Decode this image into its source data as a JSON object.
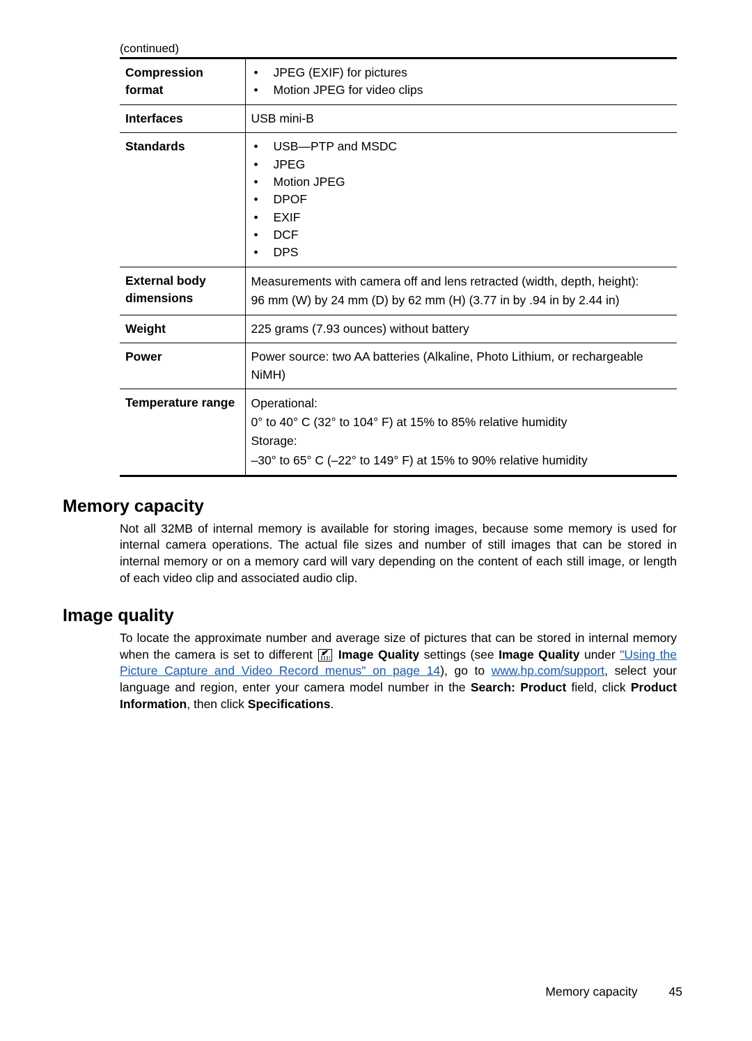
{
  "continued": "(continued)",
  "specs": {
    "compression": {
      "label": "Compression format",
      "items": [
        "JPEG (EXIF) for pictures",
        "Motion JPEG for video clips"
      ]
    },
    "interfaces": {
      "label": "Interfaces",
      "value": "USB mini-B"
    },
    "standards": {
      "label": "Standards",
      "items": [
        "USB—PTP and MSDC",
        "JPEG",
        "Motion JPEG",
        "DPOF",
        "EXIF",
        "DCF",
        "DPS"
      ]
    },
    "external": {
      "label": "External body dimensions",
      "lines": [
        "Measurements with camera off and lens retracted (width, depth, height):",
        "96 mm (W) by 24 mm (D) by 62 mm (H) (3.77 in by .94 in by 2.44 in)"
      ]
    },
    "weight": {
      "label": "Weight",
      "value": "225 grams (7.93 ounces) without battery"
    },
    "power": {
      "label": "Power",
      "value": "Power source: two AA batteries (Alkaline, Photo Lithium, or rechargeable NiMH)"
    },
    "temp": {
      "label": "Temperature range",
      "lines": [
        "Operational:",
        "0° to 40° C (32° to 104° F) at 15% to 85% relative humidity",
        "Storage:",
        "–30° to 65° C (–22° to 149° F) at 15% to 90% relative humidity"
      ]
    }
  },
  "memory": {
    "heading": "Memory capacity",
    "text": "Not all 32MB of internal memory is available for storing images, because some memory is used for internal camera operations. The actual file sizes and number of still images that can be stored in internal memory or on a memory card will vary depending on the content of each still image, or length of each video clip and associated audio clip."
  },
  "imagequality": {
    "heading": "Image quality",
    "t1": "To locate the approximate number and average size of pictures that can be stored in internal memory when the camera is set to different ",
    "bold1": "Image Quality",
    "t2": " settings (see ",
    "bold2": "Image Quality",
    "t3": " under ",
    "link1": "\"Using the Picture Capture and Video Record menus\"",
    "link1b": " on page 14",
    "t4": "), go to ",
    "link2": "www.hp.com/support",
    "t5": ", select your language and region, enter your camera model number in the ",
    "bold3": "Search: Product",
    "t6": " field, click ",
    "bold4": "Product Information",
    "t7": ", then click ",
    "bold5": "Specifications",
    "t8": "."
  },
  "footer": {
    "section": "Memory capacity",
    "page": "45"
  }
}
